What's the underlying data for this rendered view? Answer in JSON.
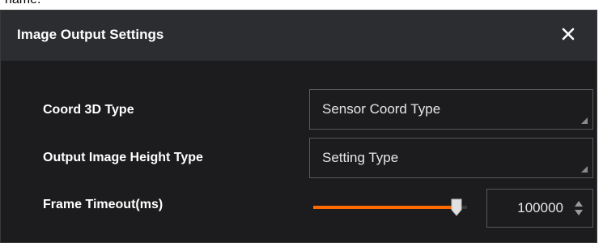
{
  "background_caption": "name.",
  "dialog": {
    "title": "Image Output Settings"
  },
  "fields": {
    "coord_type": {
      "label": "Coord 3D Type",
      "value": "Sensor Coord Type"
    },
    "height_type": {
      "label": "Output Image Height Type",
      "value": "Setting Type"
    },
    "frame_timeout": {
      "label": "Frame Timeout(ms)",
      "value": "100000",
      "slider_fraction": 0.93
    }
  },
  "colors": {
    "accent": "#ff6a00",
    "dialog_bg": "#1c1c1e",
    "titlebar_bg": "#2c2d30"
  },
  "icons": {
    "close": "close-icon",
    "spin": "spin-arrows-icon",
    "dropdown": "dropdown-corner-icon"
  }
}
